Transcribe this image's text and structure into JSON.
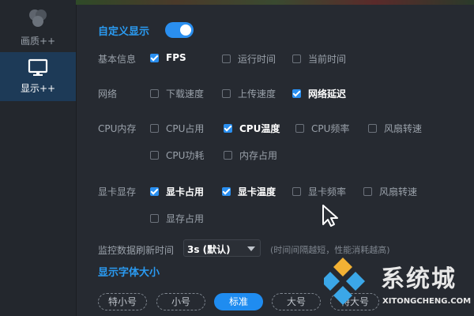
{
  "sidebar": {
    "items": [
      {
        "label": "画质++",
        "icon": "circles-icon"
      },
      {
        "label": "显示++",
        "icon": "monitor-icon",
        "active": true
      }
    ]
  },
  "display": {
    "custom_display_label": "自定义显示",
    "custom_display_enabled": true
  },
  "rows": {
    "basic": {
      "label": "基本信息",
      "options": [
        {
          "label": "FPS",
          "checked": true
        },
        {
          "label": "运行时间",
          "checked": false
        },
        {
          "label": "当前时间",
          "checked": false
        }
      ]
    },
    "network": {
      "label": "网络",
      "options": [
        {
          "label": "下载速度",
          "checked": false
        },
        {
          "label": "上传速度",
          "checked": false
        },
        {
          "label": "网络延迟",
          "checked": true
        }
      ]
    },
    "cpu": {
      "label": "CPU内存",
      "options": [
        {
          "label": "CPU占用",
          "checked": false
        },
        {
          "label": "CPU温度",
          "checked": true
        },
        {
          "label": "CPU频率",
          "checked": false
        },
        {
          "label": "风扇转速",
          "checked": false
        },
        {
          "label": "CPU功耗",
          "checked": false
        },
        {
          "label": "内存占用",
          "checked": false
        }
      ]
    },
    "gpu": {
      "label": "显卡显存",
      "options": [
        {
          "label": "显卡占用",
          "checked": true
        },
        {
          "label": "显卡温度",
          "checked": true
        },
        {
          "label": "显卡频率",
          "checked": false
        },
        {
          "label": "风扇转速",
          "checked": false
        },
        {
          "label": "显存占用",
          "checked": false
        }
      ]
    }
  },
  "refresh": {
    "label": "监控数据刷新时间",
    "value": "3s (默认)",
    "hint": "(时间间隔越短，性能消耗越高)"
  },
  "font_size": {
    "title": "显示字体大小",
    "options": [
      "特小号",
      "小号",
      "标准",
      "大号",
      "特大号"
    ],
    "selected": "标准"
  },
  "watermark": {
    "text": "系统城",
    "url": "XITONGCHENG.COM"
  },
  "colors": {
    "accent": "#2a8ff0",
    "background": "#262a31",
    "sidebar_active": "#1d3a57"
  }
}
